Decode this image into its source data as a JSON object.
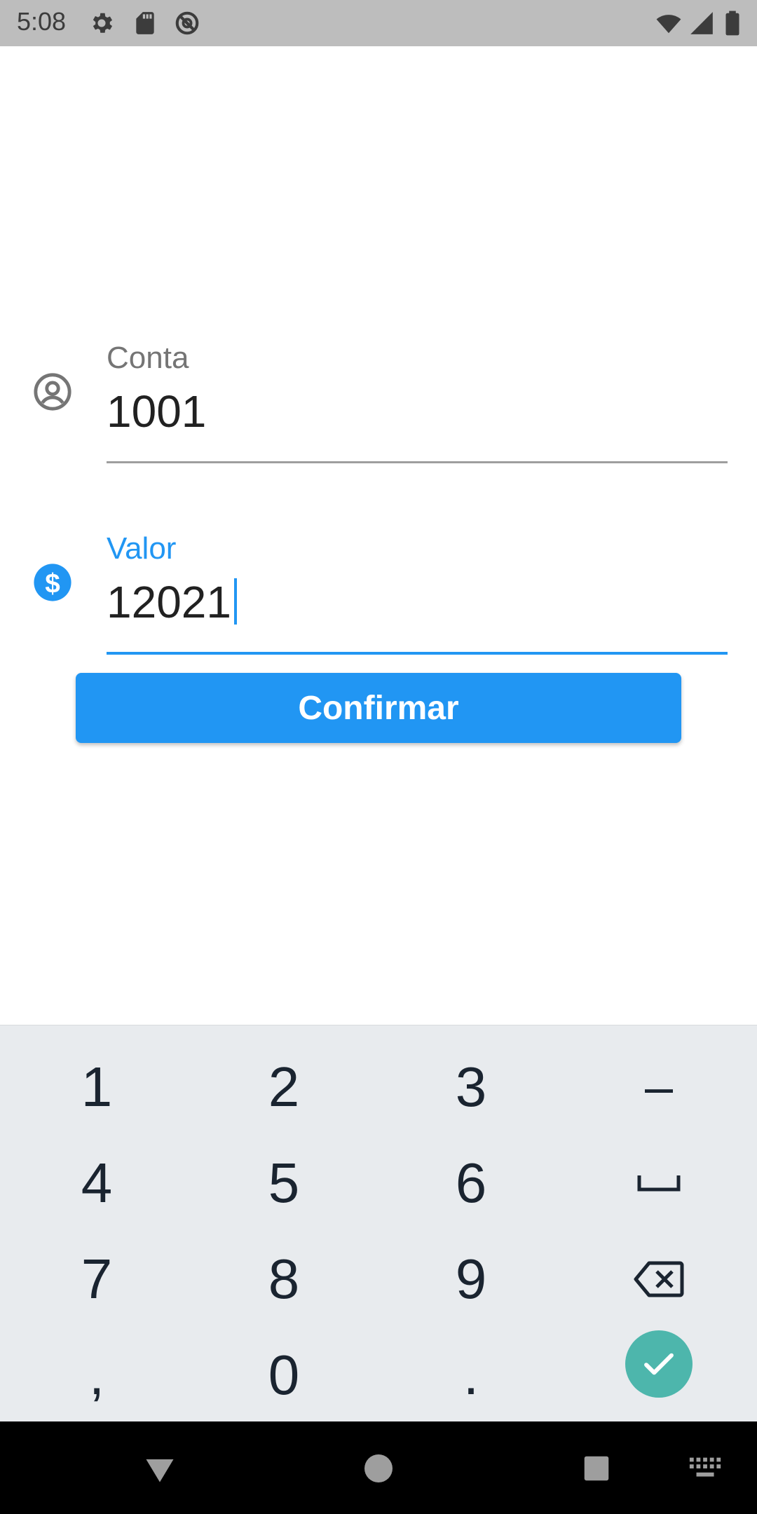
{
  "status_bar": {
    "time": "5:08",
    "left_icons": [
      "gear-icon",
      "sd-card-icon",
      "vpn-icon"
    ],
    "right_icons": [
      "wifi-icon",
      "signal-icon",
      "battery-icon"
    ]
  },
  "form": {
    "account": {
      "label": "Conta",
      "value": "1001",
      "icon": "account-circle-icon",
      "label_color": "#757575",
      "line_color": "#9e9e9e"
    },
    "amount": {
      "label": "Valor",
      "value": "12021",
      "icon": "dollar-circle-icon",
      "label_color": "#2196f3",
      "line_color": "#2196f3",
      "focused": true
    },
    "confirm_label": "Confirmar",
    "accent_color": "#2196f3"
  },
  "keyboard": {
    "keys": [
      "1",
      "2",
      "3",
      "–",
      "4",
      "5",
      "6",
      "␣",
      "7",
      "8",
      "9",
      "⌫",
      ",",
      "0",
      ".",
      "✓"
    ],
    "enter_color": "#4db6ac"
  },
  "nav_bar": {
    "buttons": [
      "back-icon",
      "home-icon",
      "recents-icon",
      "keyboard-switch-icon"
    ]
  }
}
